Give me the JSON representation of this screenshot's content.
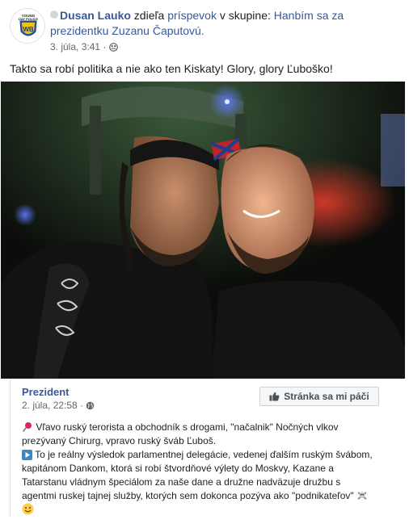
{
  "post": {
    "author": "Dusan Lauko",
    "action_text": "zdieľa",
    "shared_link": "príspevok",
    "group_prefix": "v skupine:",
    "group_name_line1": "Hanbím sa za",
    "group_name_line2": "prezidentku Zuzanu Čaputovú.",
    "timestamp": "3. júla, 3:41 ·",
    "text": "Takto sa robí politika a nie ako ten Kiskaty! Glory, glory Ľuboško!",
    "avatar_text": "YOUNG DAY POLICE",
    "privacy_icon": "group-privacy-icon"
  },
  "shared_post": {
    "page_name": "Prezident",
    "timestamp": "2. júla, 22:58 ·",
    "privacy_icon": "globe-icon",
    "like_button_label": "Stránka sa mi páči",
    "like_icon": "thumbs-up-icon",
    "text_lines": [
      "Vľavo ruský terorista a obchodník s drogami, \"načalnik\" Nočných vlkov",
      "prezývaný Chirurg, vpravo ruský šváb Ľuboš.",
      "To je reálny výsledok parlamentnej delegácie, vedenej ďalším ruským švábom,",
      "kapitánom Dankom, ktorá si robí štvordňové výlety do Moskvy, Kazane a",
      "Tatarstanu vládnym špeciálom za naše dane a družne nadväzuje družbu s",
      "agentmi ruskej tajnej služby, ktorých sem dokonca pozýva ako \"podnikateľov\""
    ],
    "emoji_icons": [
      "pushpin-icon",
      "play-button-icon",
      "skull-crossbones-icon",
      "smile-icon"
    ]
  },
  "colors": {
    "link": "#385898",
    "meta": "#616770",
    "text": "#1c1e21",
    "border": "#dddfe2"
  }
}
